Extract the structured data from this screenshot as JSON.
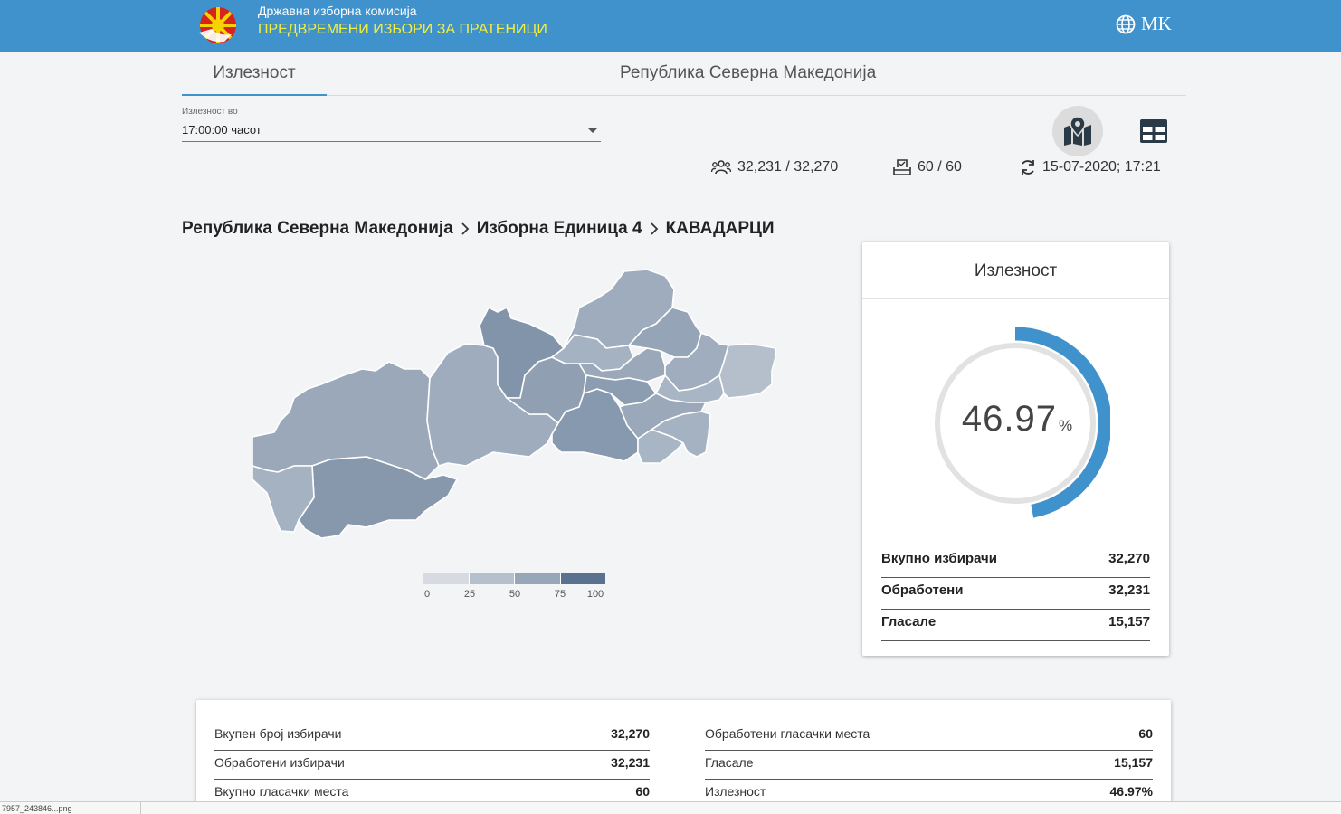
{
  "header": {
    "org_name": "Државна изборна комисија",
    "election_name": "ПРЕДВРЕМЕНИ ИЗБОРИ ЗА ПРАТЕНИЦИ",
    "language": "MK"
  },
  "tabs": {
    "turnout_tab": "Излезност",
    "region_title": "Република Северна Македонија"
  },
  "time_select": {
    "label": "Излезност во",
    "value": "17:00:00 часот"
  },
  "stats": {
    "voters_processed": "32,231 / 32,270",
    "stations_processed": "60 / 60",
    "updated": "15-07-2020; 17:21"
  },
  "breadcrumb": [
    "Република Северна Македонија",
    "Изборна Единица 4",
    "КАВАДАРЦИ"
  ],
  "legend": {
    "ticks": [
      "0",
      "25",
      "50",
      "75",
      "100"
    ],
    "colors": [
      "#d7dbe1",
      "#b6c0cc",
      "#98a7b8",
      "#7a8ea5",
      "#5a7190"
    ]
  },
  "turnout_card": {
    "title": "Излезност",
    "percent": 46.97,
    "percent_text": "46.97",
    "unit": "%",
    "rows": [
      {
        "label": "Вкупно избирачи",
        "value": "32,270"
      },
      {
        "label": "Обработени",
        "value": "32,231"
      },
      {
        "label": "Гласале",
        "value": "15,157"
      }
    ]
  },
  "summary": {
    "left": [
      {
        "label": "Вкупен број избирачи",
        "value": "32,270"
      },
      {
        "label": "Обработени избирачи",
        "value": "32,231"
      },
      {
        "label": "Вкупно гласачки места",
        "value": "60"
      }
    ],
    "right": [
      {
        "label": "Обработени гласачки места",
        "value": "60"
      },
      {
        "label": "Гласале",
        "value": "15,157"
      },
      {
        "label": "Излезност",
        "value": "46.97%"
      }
    ]
  },
  "status_bar": {
    "text": "7957_243846...png"
  },
  "colors": {
    "header_bg": "#3f92cc",
    "accent": "#3f92cc",
    "election_title": "#f4ee3e",
    "map_fill": "#98a7b8"
  }
}
